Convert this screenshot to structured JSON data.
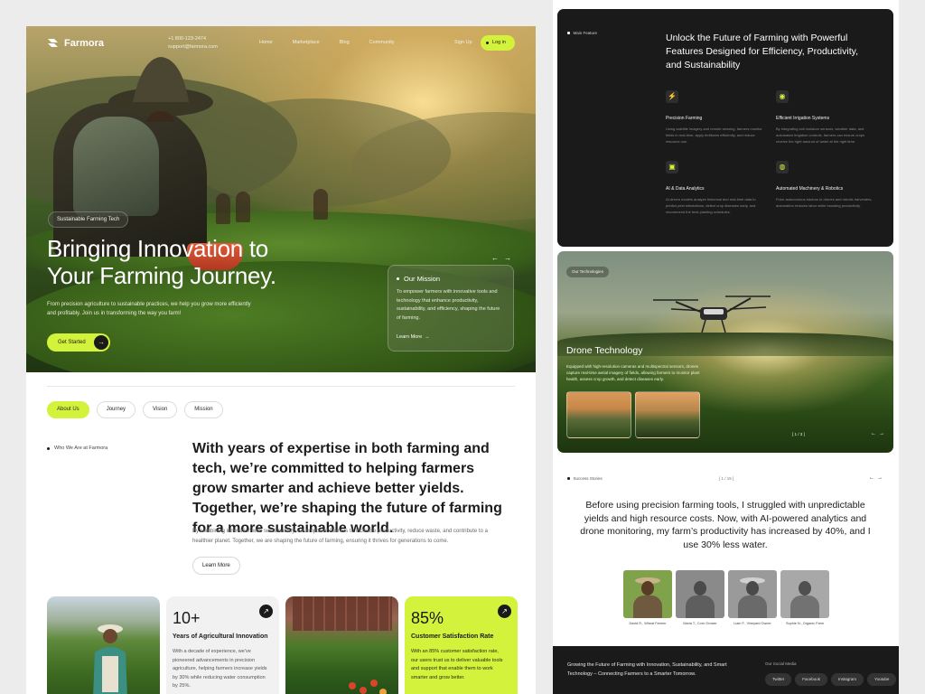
{
  "brand": {
    "name": "Farmora"
  },
  "contact": {
    "phone": "+1 800-123-2474",
    "email": "support@farmora.com"
  },
  "nav": {
    "links": [
      "Home",
      "Marketplace",
      "Blog",
      "Community"
    ],
    "signup": "Sign Up",
    "login": "Log in"
  },
  "hero": {
    "badge": "Sustainable Farming Tech",
    "title": "Bringing Innovation to Your Farming Journey.",
    "subtitle": "From precision agriculture to sustainable practices, we help you grow more efficiently and profitably. Join us in transforming the way you farm!",
    "cta": "Get Started",
    "mission": {
      "title": "Our Mission",
      "text": "To empower farmers with innovative tools and technology that enhance productivity, sustainability, and efficiency, shaping the future of farming.",
      "link": "Learn More"
    }
  },
  "tabs": [
    "About Us",
    "Journey",
    "Vision",
    "Mission"
  ],
  "about": {
    "tag": "Who We Are at Farmora",
    "title": "With years of expertise in both farming and tech, we’re committed to helping farmers grow smarter and achieve better yields. Together, we’re shaping the future of farming for a more sustainable world.",
    "text": "By combining innovation with sustainability, we empower farmers to increase productivity, reduce waste, and contribute to a healthier planet. Together, we are shaping the future of farming, ensuring it thrives for generations to come.",
    "button": "Learn More"
  },
  "stats": [
    {
      "number": "10+",
      "label": "Years of Agricultural Innovation",
      "text": "With a decade of experience, we’ve pioneered advancements in precision agriculture, helping farmers increase yields by 30% while reducing water consumption by 25%."
    },
    {
      "number": "85%",
      "label": "Customer Satisfaction Rate",
      "text": "With an 85% customer satisfaction rate, our users trust us to deliver valuable tools and support that enable them to work smarter and grow better."
    }
  ],
  "features": {
    "tag": "Main Feature",
    "title": "Unlock the Future of Farming with Powerful Features Designed for Efficiency, Productivity, and Sustainability",
    "items": [
      {
        "name": "Precision Farming",
        "desc": "Using satellite imagery and remote sensing, farmers monitor fields in real-time, apply fertilizers efficiently, and reduce resource use."
      },
      {
        "name": "Efficient Irrigation Systems",
        "desc": "By integrating soil moisture sensors, weather data, and automated irrigation controls, farmers can ensure crops receive the right amount of water at the right time."
      },
      {
        "name": "AI & Data Analytics",
        "desc": "AI-driven models analyze historical and real-time data to predict pest infestations, detect crop diseases early, and recommend the best planting schedules."
      },
      {
        "name": "Automated Machinery & Robotics",
        "desc": "From autonomous tractors to drones and robotic harvesters, automation reduces labor while boosting productivity."
      }
    ]
  },
  "technologies": {
    "tag": "Our Technologies",
    "title": "Drone Technology",
    "text": "Equipped with high-resolution cameras and multispectral sensors, drones capture real-time aerial imagery of fields, allowing farmers to monitor plant health, assess crop growth, and detect diseases early.",
    "counter": "[ 1 / 3 ]"
  },
  "stories": {
    "tag": "Success Stories",
    "counter": "[ 1 / 15 ]",
    "quote": "Before using precision farming tools, I struggled with unpredictable yields and high resource costs. Now, with AI-powered analytics and drone monitoring, my farm’s productivity has increased by 40%, and I use 30% less water.",
    "people": [
      {
        "name": "David R., Wheat Farmer",
        "bg": "#7fa24a"
      },
      {
        "name": "Maria T., Corn Grower",
        "bg": "#8a8a8a"
      },
      {
        "name": "Liam F., Vineyard Owner",
        "bg": "#9a9a9a"
      },
      {
        "name": "Sophie N., Organic Farm",
        "bg": "#a8a8a8"
      }
    ]
  },
  "footer": {
    "text": "Growing the Future of Farming with Innovation, Sustainability, and Smart Technology – Connecting Farmers to a Smarter Tomorrow.",
    "social_label": "Our Social Media",
    "social": [
      "Twitter",
      "Facebook",
      "Instagram",
      "Youtube"
    ]
  },
  "colors": {
    "accent": "#d3f23c",
    "dark": "#1a1a1a"
  },
  "icons": [
    "logo-mark-icon",
    "arrow-right-icon",
    "arrow-left-icon",
    "bolt-icon",
    "water-icon",
    "chip-icon",
    "robot-icon"
  ]
}
